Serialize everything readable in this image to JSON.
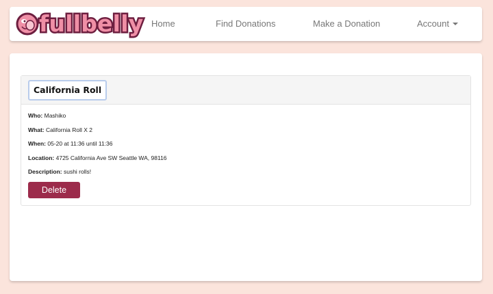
{
  "brand": {
    "name": "fullbelly",
    "logo_icon": "smiling-belly-icon"
  },
  "nav": {
    "home": "Home",
    "find_donations": "Find Donations",
    "make_donation": "Make a Donation",
    "account": "Account"
  },
  "donation": {
    "title": "California Roll",
    "who_label": "Who:",
    "who": "Mashiko",
    "what_label": "What:",
    "what": "California Roll X 2",
    "when_label": "When:",
    "when": "05-20 at 11:36 until 11:36",
    "location_label": "Location:",
    "location": "4725 California Ave SW Seattle WA, 98116",
    "description_label": "Description:",
    "description": "sushi rolls!",
    "delete_label": "Delete"
  },
  "colors": {
    "page_bg": "#fbe4dc",
    "brand_pink": "#ef8fa6",
    "brand_maroon": "#6d1e3f",
    "delete_button": "#9c2b4b"
  }
}
